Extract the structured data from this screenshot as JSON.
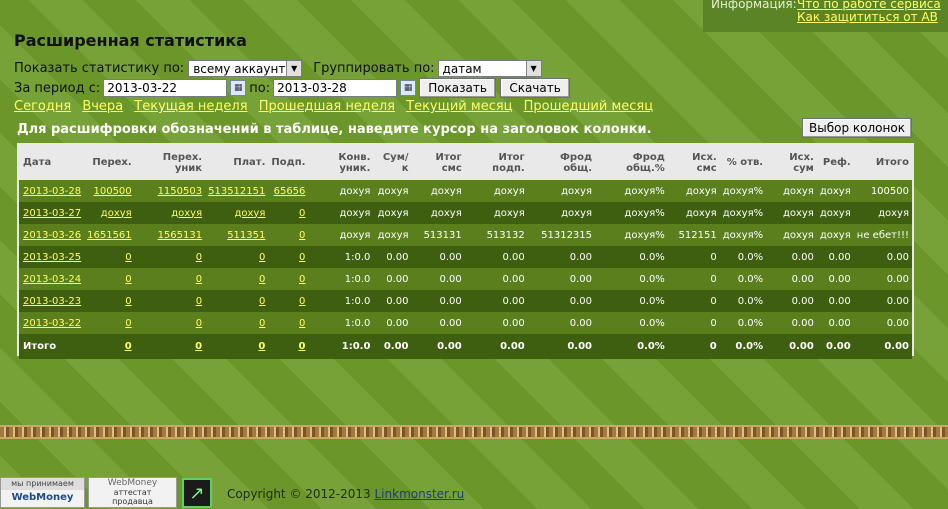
{
  "top_info": {
    "label": "Информация:",
    "link1": "Что по работе сервиса",
    "link2": "Как защититься от AB"
  },
  "title": "Расширенная статистика",
  "filters": {
    "show_label": "Показать статистику по:",
    "show_value": "всему аккаунту",
    "group_label": "Группировать по:",
    "group_value": "датам",
    "period_label": "За период с:",
    "date_from": "2013-03-22",
    "to_label": "по:",
    "date_to": "2013-03-28",
    "show_button": "Показать",
    "download_button": "Скачать"
  },
  "quick_links": [
    "Сегодня",
    "Вчера",
    "Текущая неделя",
    "Прошедшая неделя",
    "Текущий месяц",
    "Прошедший месяц"
  ],
  "hint": "Для расшифровки обозначений в таблице, наведите курсор на заголовок колонки.",
  "columns_button": "Выбор колонок",
  "table": {
    "headers": [
      "Дата",
      "Перех.",
      "Перех. уник",
      "Плат.",
      "Подп.",
      "Конв. уник.",
      "Сум/к",
      "Итог смс",
      "Итог подп.",
      "Фрод общ.",
      "Фрод общ.%",
      "Исх. смс",
      "% отв.",
      "Исх. сум",
      "Реф.",
      "Итого"
    ],
    "rows": [
      [
        "2013-03-28",
        "100500",
        "1150503",
        "513512151",
        "65656",
        "дохуя",
        "дохуя",
        "дохуя",
        "дохуя",
        "дохуя",
        "дохуя%",
        "дохуя",
        "дохуя%",
        "дохуя",
        "дохуя",
        "100500"
      ],
      [
        "2013-03-27",
        "дохуя",
        "дохуя",
        "дохуя",
        "0",
        "дохуя",
        "дохуя",
        "дохуя",
        "дохуя",
        "дохуя",
        "дохуя%",
        "дохуя",
        "дохуя%",
        "дохуя",
        "дохуя",
        "дохуя"
      ],
      [
        "2013-03-26",
        "1651561",
        "1565131",
        "511351",
        "0",
        "дохуя",
        "дохуя",
        "513131",
        "513132",
        "51312315",
        "дохуя%",
        "512151",
        "дохуя%",
        "дохуя",
        "дохуя",
        "не ебет!!!"
      ],
      [
        "2013-03-25",
        "0",
        "0",
        "0",
        "0",
        "1:0.0",
        "0.00",
        "0.00",
        "0.00",
        "0.00",
        "0.0%",
        "0",
        "0.0%",
        "0.00",
        "0.00",
        "0.00"
      ],
      [
        "2013-03-24",
        "0",
        "0",
        "0",
        "0",
        "1:0.0",
        "0.00",
        "0.00",
        "0.00",
        "0.00",
        "0.0%",
        "0",
        "0.0%",
        "0.00",
        "0.00",
        "0.00"
      ],
      [
        "2013-03-23",
        "0",
        "0",
        "0",
        "0",
        "1:0.0",
        "0.00",
        "0.00",
        "0.00",
        "0.00",
        "0.0%",
        "0",
        "0.0%",
        "0.00",
        "0.00",
        "0.00"
      ],
      [
        "2013-03-22",
        "0",
        "0",
        "0",
        "0",
        "1:0.0",
        "0.00",
        "0.00",
        "0.00",
        "0.00",
        "0.0%",
        "0",
        "0.0%",
        "0.00",
        "0.00",
        "0.00"
      ]
    ],
    "total": [
      "Итого",
      "0",
      "0",
      "0",
      "0",
      "1:0.0",
      "0.00",
      "0.00",
      "0.00",
      "0.00",
      "0.0%",
      "0",
      "0.0%",
      "0.00",
      "0.00",
      "0.00"
    ]
  },
  "footer": {
    "badge1_top": "мы принимаем",
    "badge1_bottom": "WebMoney",
    "badge2_top": "WebMoney",
    "badge2_mid": "аттестат",
    "badge2_bottom": "продавца",
    "copyright": "Copyright © 2012-2013",
    "site": "Linkmonster.ru"
  }
}
